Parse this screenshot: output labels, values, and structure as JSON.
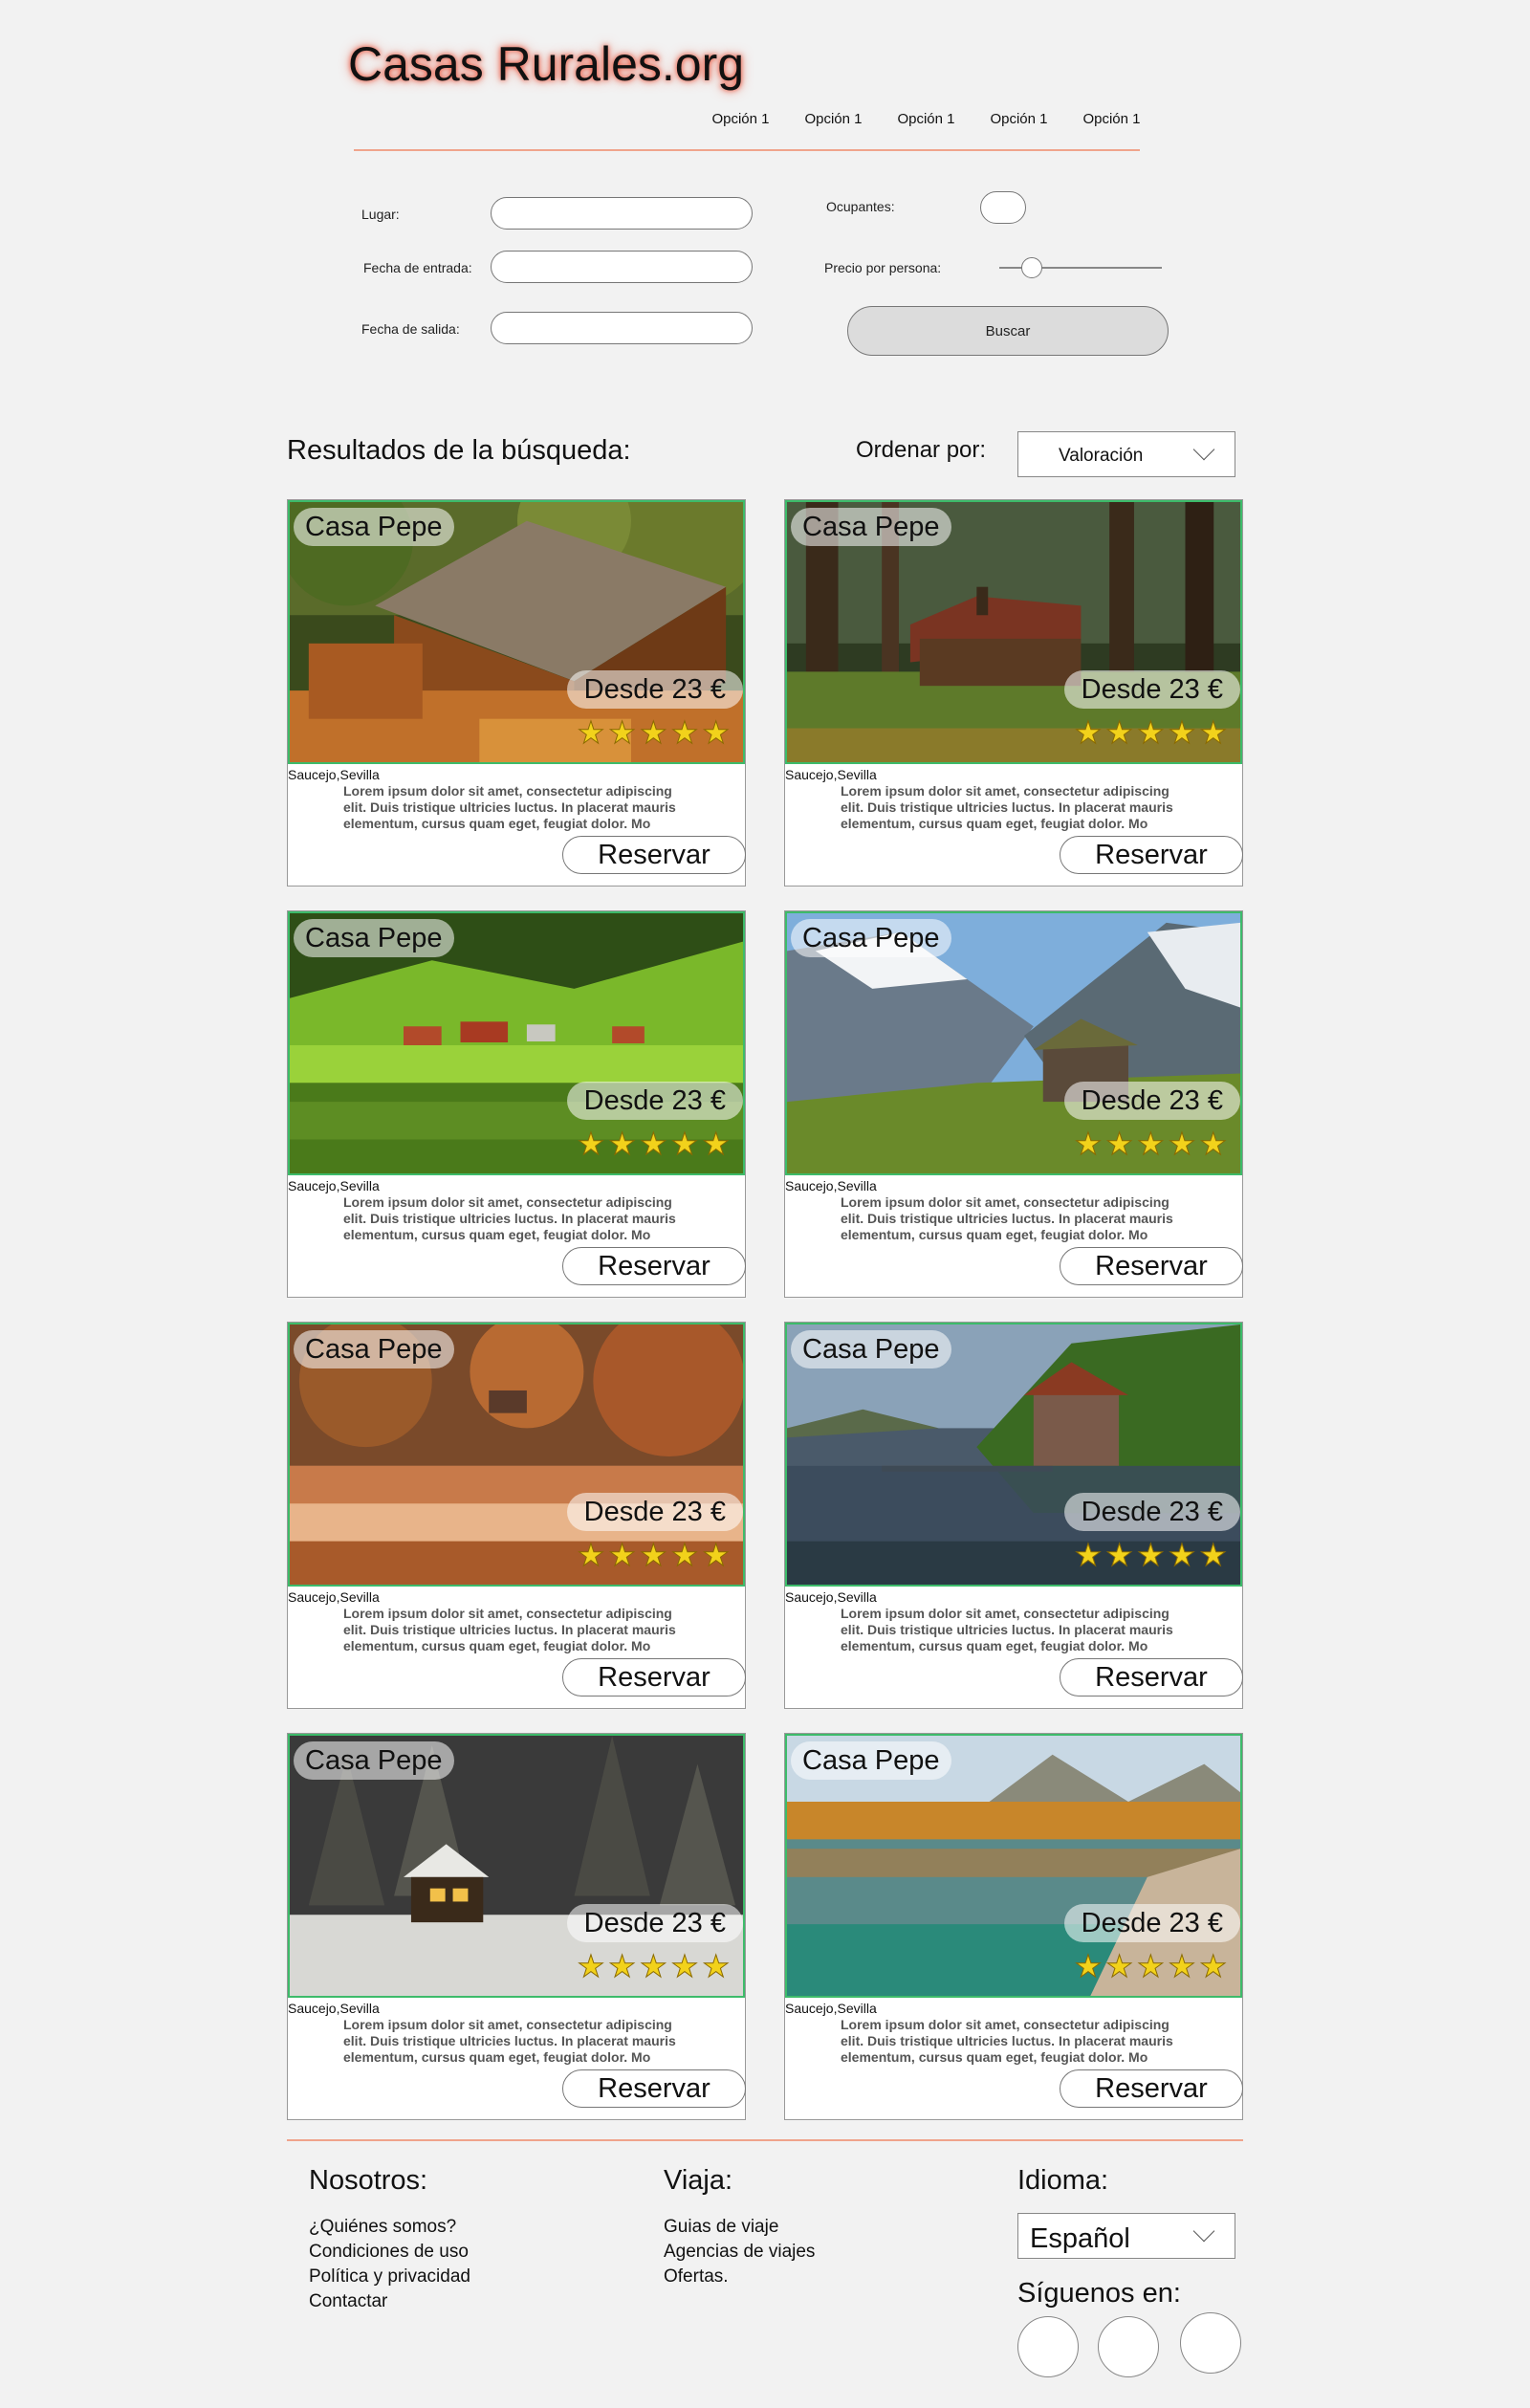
{
  "site": {
    "logo": "Casas Rurales.org"
  },
  "nav": [
    "Opción 1",
    "Opción 1",
    "Opción 1",
    "Opción 1",
    "Opción 1"
  ],
  "search": {
    "place_label": "Lugar:",
    "checkin_label": "Fecha de entrada:",
    "checkout_label": "Fecha de salida:",
    "occupants_label": "Ocupantes:",
    "price_label": "Precio por persona:",
    "price_slider_fraction": 0.2,
    "search_button": "Buscar"
  },
  "results": {
    "title": "Resultados de la búsqueda:",
    "sort_label": "Ordenar por:",
    "sort_value": "Valoración",
    "cards": [
      {
        "name": "Casa Pepe",
        "price": "Desde 23 €",
        "rating": 5,
        "location": "Saucejo,Sevilla",
        "description": "Lorem ipsum dolor sit amet, consectetur adipiscing elit. Duis tristique ultricies luctus. In placerat mauris elementum, cursus quam eget, feugiat dolor. Mo",
        "button": "Reservar"
      },
      {
        "name": "Casa Pepe",
        "price": "Desde 23 €",
        "rating": 5,
        "location": "Saucejo,Sevilla",
        "description": "Lorem ipsum dolor sit amet, consectetur adipiscing elit. Duis tristique ultricies luctus. In placerat mauris elementum, cursus quam eget, feugiat dolor. Mo",
        "button": "Reservar"
      },
      {
        "name": "Casa Pepe",
        "price": "Desde 23 €",
        "rating": 5,
        "location": "Saucejo,Sevilla",
        "description": "Lorem ipsum dolor sit amet, consectetur adipiscing elit. Duis tristique ultricies luctus. In placerat mauris elementum, cursus quam eget, feugiat dolor. Mo",
        "button": "Reservar"
      },
      {
        "name": "Casa Pepe",
        "price": "Desde 23 €",
        "rating": 5,
        "location": "Saucejo,Sevilla",
        "description": "Lorem ipsum dolor sit amet, consectetur adipiscing elit. Duis tristique ultricies luctus. In placerat mauris elementum, cursus quam eget, feugiat dolor. Mo",
        "button": "Reservar"
      },
      {
        "name": "Casa Pepe",
        "price": "Desde 23 €",
        "rating": 5,
        "location": "Saucejo,Sevilla",
        "description": "Lorem ipsum dolor sit amet, consectetur adipiscing elit. Duis tristique ultricies luctus. In placerat mauris elementum, cursus quam eget, feugiat dolor. Mo",
        "button": "Reservar"
      },
      {
        "name": "Casa Pepe",
        "price": "Desde 23 €",
        "rating": 5,
        "location": "Saucejo,Sevilla",
        "description": "Lorem ipsum dolor sit amet, consectetur adipiscing elit. Duis tristique ultricies luctus. In placerat mauris elementum, cursus quam eget, feugiat dolor. Mo",
        "button": "Reservar"
      },
      {
        "name": "Casa Pepe",
        "price": "Desde 23 €",
        "rating": 5,
        "location": "Saucejo,Sevilla",
        "description": "Lorem ipsum dolor sit amet, consectetur adipiscing elit. Duis tristique ultricies luctus. In placerat mauris elementum, cursus quam eget, feugiat dolor. Mo",
        "button": "Reservar"
      },
      {
        "name": "Casa Pepe",
        "price": "Desde 23 €",
        "rating": 5,
        "location": "Saucejo,Sevilla",
        "description": "Lorem ipsum dolor sit amet, consectetur adipiscing elit. Duis tristique ultricies luctus. In placerat mauris elementum, cursus quam eget, feugiat dolor. Mo",
        "button": "Reservar"
      }
    ]
  },
  "footer": {
    "about": {
      "title": "Nosotros:",
      "links": [
        "¿Quiénes somos?",
        "Condiciones de uso",
        "Política y privacidad",
        "Contactar"
      ]
    },
    "travel": {
      "title": "Viaja:",
      "links": [
        "Guias de viaje",
        "Agencias de viajes",
        "Ofertas."
      ]
    },
    "language": {
      "title": "Idioma:",
      "value": "Español"
    },
    "follow": {
      "title": "Síguenos en:"
    }
  },
  "colors": {
    "accent_line": "#f0a48c",
    "image_border": "#3dbb6a",
    "star": "#f2d21b",
    "logo_glow": "#e8442a"
  }
}
